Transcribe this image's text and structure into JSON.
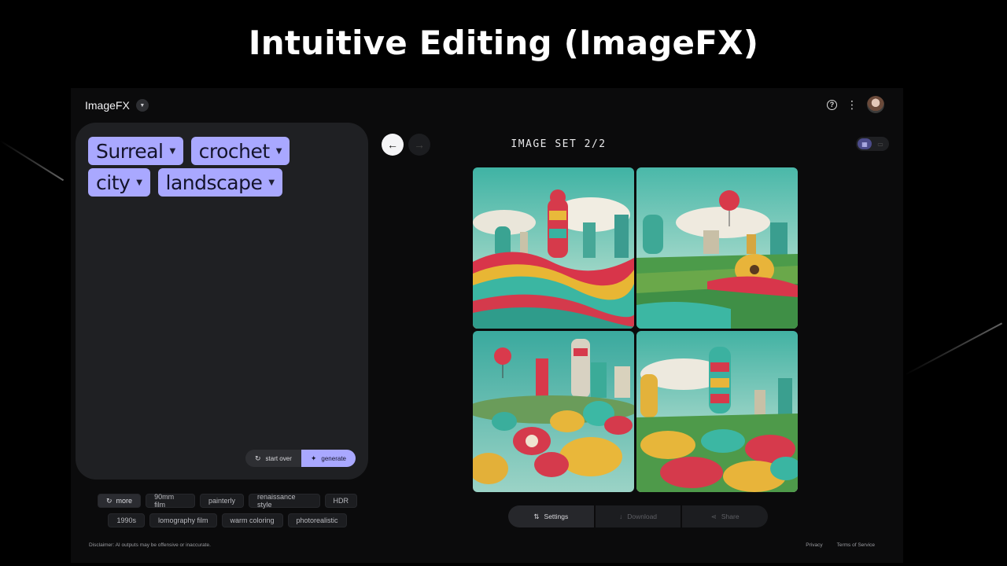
{
  "slide": {
    "title": "Intuitive Editing (ImageFX)"
  },
  "app": {
    "brand": "ImageFX",
    "prompt_chips": [
      {
        "label": "Surreal"
      },
      {
        "label": "crochet"
      },
      {
        "label": "city"
      },
      {
        "label": "landscape"
      }
    ],
    "actions": {
      "start_over": "start over",
      "generate": "generate"
    },
    "suggestions": {
      "more": "more",
      "row1": [
        "90mm film",
        "painterly",
        "renaissance style",
        "HDR"
      ],
      "row2": [
        "1990s",
        "lomography film",
        "warm coloring",
        "photorealistic"
      ]
    },
    "set_label": "IMAGE SET 2/2",
    "toolbar": {
      "settings": "Settings",
      "download": "Download",
      "share": "Share"
    },
    "disclaimer": "Disclaimer: AI outputs may be offensive or inaccurate.",
    "footer": {
      "privacy": "Privacy",
      "terms": "Terms of Service"
    },
    "colors": {
      "accent": "#a9a8ff",
      "panel": "#1f2023",
      "background": "#0b0b0c"
    },
    "icons": {
      "help": "help-circle-icon",
      "more": "more-vertical-icon",
      "prev": "arrow-left-icon",
      "next": "arrow-right-icon",
      "settings": "sliders-icon",
      "download": "download-icon",
      "share": "share-icon"
    }
  }
}
